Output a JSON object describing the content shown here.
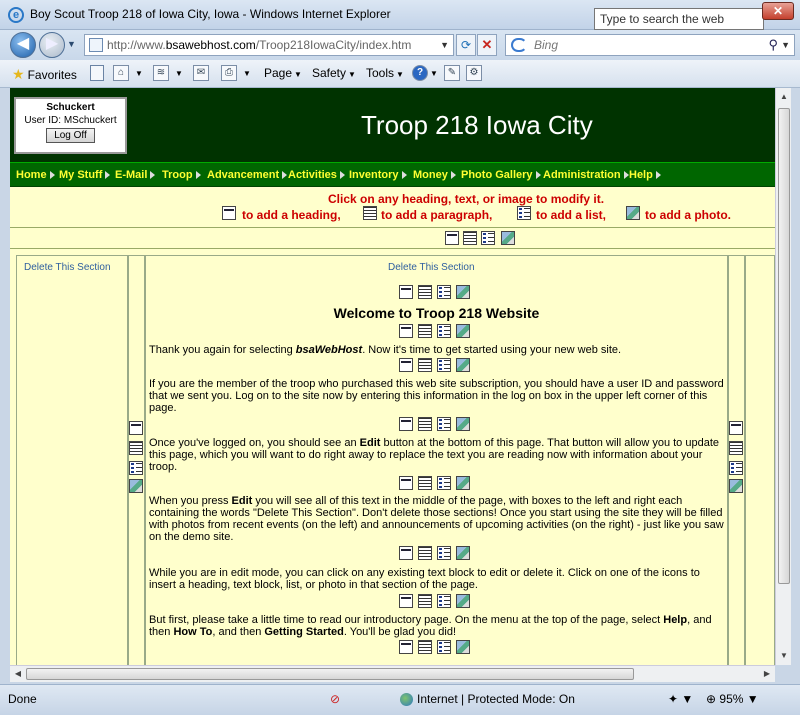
{
  "window": {
    "title": "Boy Scout Troop 218 of Iowa City, Iowa - Windows Internet Explorer",
    "tooltip": "Type to search the web (Ctrl+E)",
    "close_label": "✕"
  },
  "address": {
    "url_prefix": "http://www.",
    "url_domain": "bsawebhost.com",
    "url_path": "/Troop218IowaCity/index.htm",
    "search_placeholder": "Bing"
  },
  "command_bar": {
    "favorites_label": "Favorites",
    "page_label": "Page",
    "safety_label": "Safety",
    "tools_label": "Tools"
  },
  "login": {
    "name": "Schuckert",
    "user_id": "User ID:  MSchuckert",
    "logoff_label": "Log Off"
  },
  "site_title": "Troop 218 Iowa City",
  "menu": [
    "Home",
    "My Stuff",
    "E-Mail",
    "Troop",
    "Advancement",
    "Activities",
    "Inventory",
    "Money",
    "Photo Gallery",
    "Administration",
    "Help"
  ],
  "hints": {
    "line1": "Click on any heading, text, or image to modify it.",
    "add_heading": "to add a heading,",
    "add_paragraph": "to add a paragraph,",
    "add_list": "to add a list,",
    "add_photo": "to add a photo."
  },
  "delete_section_label": "Delete This Section",
  "content": {
    "heading": "Welcome to Troop 218 Website",
    "p1_a": "Thank you again for selecting ",
    "p1_b": "bsaWebHost",
    "p1_c": ". Now it's time to get started using your new web site.",
    "p2": "If you are the member of the troop who purchased this web site subscription, you should have a user ID and password that we sent you. Log on to the site now by entering this information in the log on box in the upper left corner of this page.",
    "p3_a": "Once you've logged on, you should see an ",
    "p3_b": "Edit",
    "p3_c": " button at the bottom of this page. That button will allow you to update this page, which you will want to do right away to replace the text you are reading now with information about your troop.",
    "p4_a": "When you press ",
    "p4_b": "Edit",
    "p4_c": " you will see all of this text in the middle of the page, with boxes to the left and right each containing the words \"Delete This Section\". Don't delete those sections! Once you start using the site they will be filled with photos from recent events (on the left) and announcements of upcoming activities (on the right) - just like you saw on the demo site.",
    "p5": "While you are in edit mode, you can click on any existing text block to edit or delete it. Click on one of the icons to insert a heading, text block, list, or photo in that section of the page.",
    "p6_a": "But first, please take a little time to read our introductory page. On the menu at the top of the page, select ",
    "p6_b": "Help",
    "p6_c": ", and then ",
    "p6_d": "How To",
    "p6_e": ", and then ",
    "p6_f": "Getting Started",
    "p6_g": ". You'll be glad you did!"
  },
  "status": {
    "left": "Done",
    "zone": "Internet | Protected Mode: On",
    "zoom": "95%"
  },
  "colors": {
    "banner": "#003300",
    "menu_bg": "#006600",
    "menu_text": "#ffff33",
    "page_bg": "#ffffcc",
    "hint_text": "#cc0000"
  }
}
